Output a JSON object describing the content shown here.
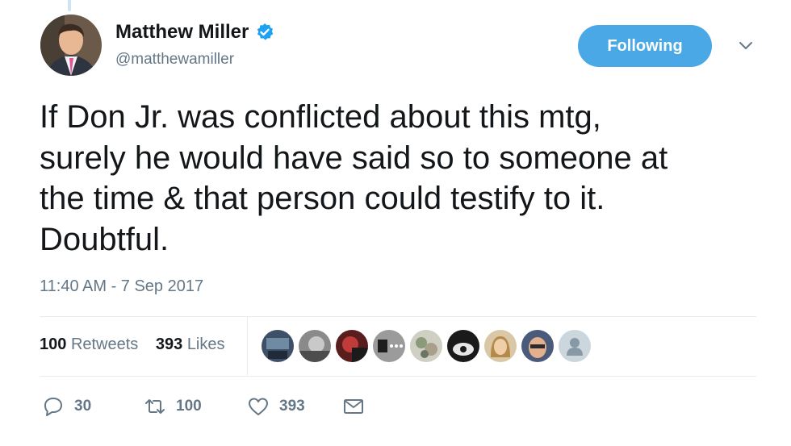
{
  "tweet": {
    "author": {
      "name": "Matthew Miller",
      "handle": "@matthewamiller",
      "verified": true
    },
    "follow_button": "Following",
    "lines": [
      "If Don Jr. was conflicted about this mtg,",
      "surely he would have said so to someone at",
      "the time & that person could testify to it.",
      "Doubtful."
    ],
    "timestamp": "11:40 AM - 7 Sep 2017",
    "stats": {
      "retweets_count": "100",
      "retweets_label": "Retweets",
      "likes_count": "393",
      "likes_label": "Likes"
    },
    "actions": {
      "reply_count": "30",
      "retweet_count": "100",
      "like_count": "393"
    }
  },
  "icons": [
    "verified-badge-icon",
    "chevron-down-icon",
    "reply-icon",
    "retweet-icon",
    "like-icon",
    "direct-message-icon"
  ],
  "colors": {
    "accent": "#4aa8e6",
    "text": "#14171a",
    "secondary": "#657786",
    "divider": "#e6ecf0"
  }
}
